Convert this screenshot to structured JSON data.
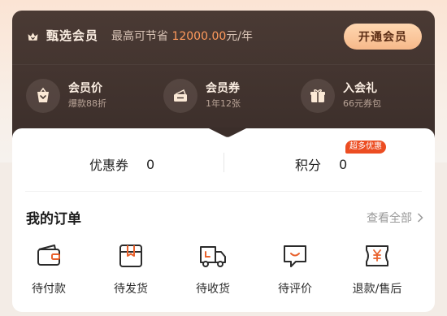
{
  "membership": {
    "title": "甄选会员",
    "save_text": "最高可节省",
    "save_amount": "12000.00",
    "save_unit": "元/年",
    "open_button": "开通会员",
    "benefits": [
      {
        "icon": "heart-bag-icon",
        "title": "会员价",
        "subtitle": "爆款88折"
      },
      {
        "icon": "coupon-ticket-icon",
        "title": "会员券",
        "subtitle": "1年12张"
      },
      {
        "icon": "gift-box-icon",
        "title": "入会礼",
        "subtitle": "66元券包"
      }
    ]
  },
  "assets": {
    "coupon_label": "优惠券",
    "coupon_value": "0",
    "points_label": "积分",
    "points_value": "0",
    "points_badge": "超多优惠"
  },
  "orders": {
    "title": "我的订单",
    "view_all": "查看全部",
    "items": [
      {
        "icon": "wallet-icon",
        "label": "待付款"
      },
      {
        "icon": "package-icon",
        "label": "待发货"
      },
      {
        "icon": "truck-icon",
        "label": "待收货"
      },
      {
        "icon": "comment-icon",
        "label": "待评价"
      },
      {
        "icon": "refund-icon",
        "label": "退款/售后"
      }
    ]
  },
  "colors": {
    "accent": "#ff9a5c",
    "card_dark": "#3b2e2a",
    "button": "#f6b98a",
    "badge": "#ec4d22"
  }
}
